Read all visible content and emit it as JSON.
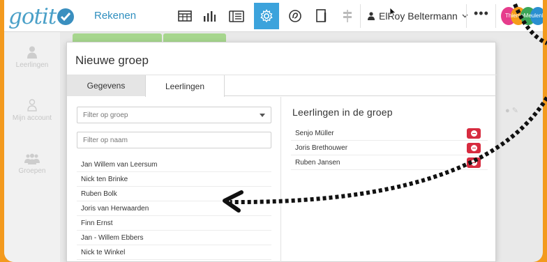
{
  "app": {
    "logo_text": "gotit",
    "name": "Rekenen"
  },
  "toolbar": {
    "icons": [
      "grid-table-icon",
      "bar-chart-icon",
      "list-card-icon",
      "gear-icon",
      "at-sign-icon",
      "document-icon",
      "signpost-icon"
    ],
    "active_icon": "gear-icon"
  },
  "user": {
    "name": "ElRoy Beltermann",
    "menu_more": "•••"
  },
  "brand": {
    "text": "ThiemeMeulenhoff"
  },
  "sidebar": {
    "items": [
      {
        "label": "Leerlingen",
        "icon": "user-icon"
      },
      {
        "label": "Mijn account",
        "icon": "user-outline-icon"
      },
      {
        "label": "Groepen",
        "icon": "group-icon"
      }
    ]
  },
  "modal": {
    "title": "Nieuwe groep",
    "tabs": [
      {
        "label": "Gegevens",
        "active": false
      },
      {
        "label": "Leerlingen",
        "active": true
      }
    ],
    "filter_group": {
      "placeholder": "Filter op groep"
    },
    "filter_name": {
      "placeholder": "Filter op naam"
    },
    "students": [
      "Jan Willem van Leersum",
      "Nick ten Brinke",
      "Ruben Bolk",
      "Joris van Herwaarden",
      "Finn Ernst",
      "Jan - Willem Ebbers",
      "Nick te Winkel"
    ],
    "group_title": "Leerlingen in de groep",
    "group_members": [
      "Senjo Müller",
      "Joris Brethouwer",
      "Ruben Jansen"
    ]
  },
  "colors": {
    "accent": "#3ca3dc",
    "frame": "#f39a1e",
    "remove": "#d72b3f",
    "logo": "#4aa0c8"
  }
}
